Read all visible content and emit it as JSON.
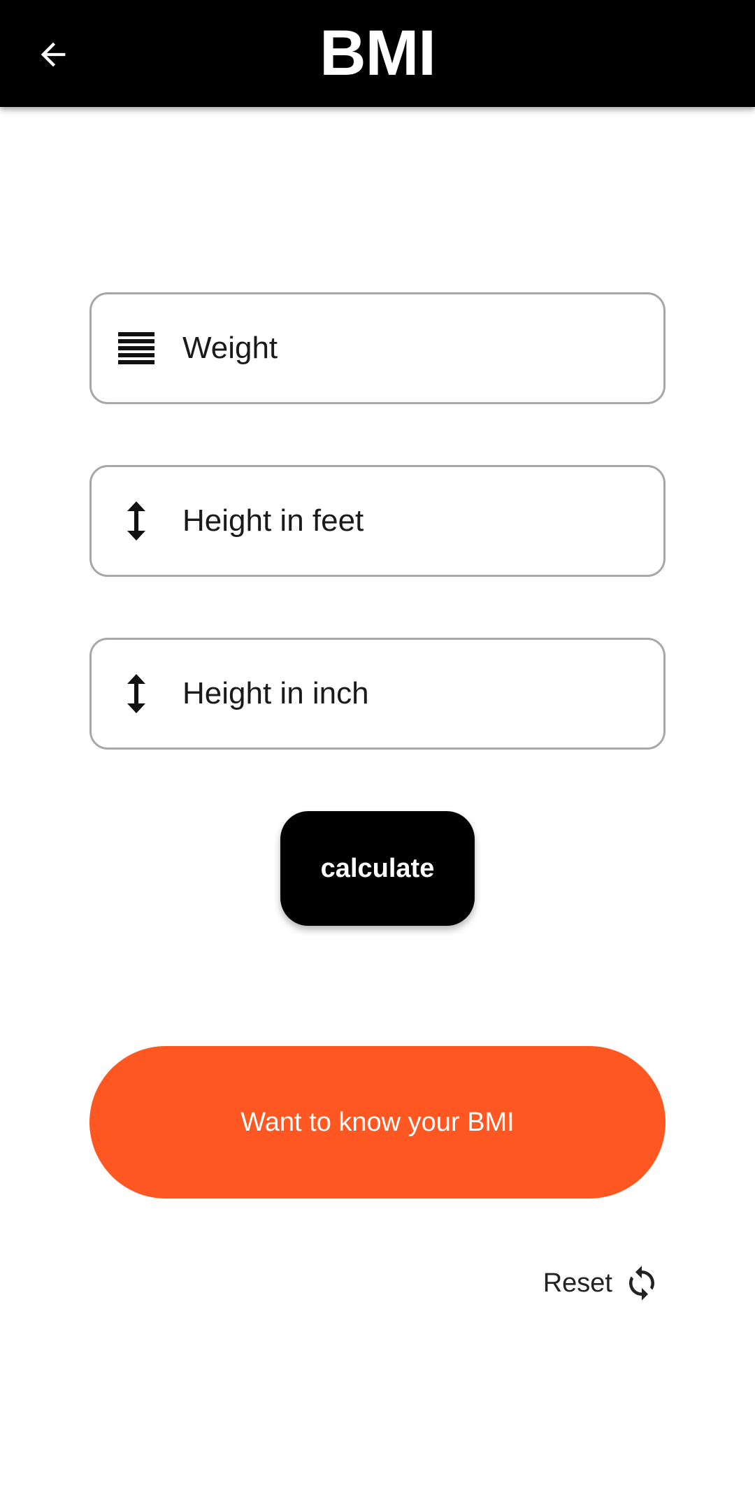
{
  "appbar": {
    "title": "BMI",
    "back_icon": "arrow-left-icon"
  },
  "form": {
    "weight": {
      "placeholder": "Weight",
      "value": "",
      "icon": "weight-lines-icon"
    },
    "height_feet": {
      "placeholder": "Height in feet",
      "value": "",
      "icon": "vertical-arrows-icon"
    },
    "height_inch": {
      "placeholder": "Height in inch",
      "value": "",
      "icon": "vertical-arrows-icon"
    }
  },
  "actions": {
    "calculate_label": "calculate",
    "result_label": "Want to know your BMI",
    "reset_label": "Reset",
    "reset_icon": "refresh-icon"
  },
  "colors": {
    "appbar_bg": "#000000",
    "accent": "#ff5722",
    "calculate_bg": "#000000",
    "field_border": "#a7a7a7"
  }
}
